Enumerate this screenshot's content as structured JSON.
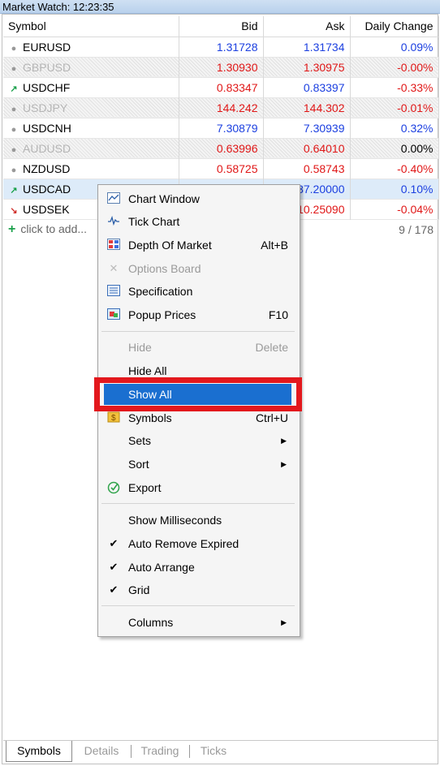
{
  "window": {
    "title": "Market Watch: 12:23:35"
  },
  "columns": {
    "symbol": "Symbol",
    "bid": "Bid",
    "ask": "Ask",
    "change": "Daily Change"
  },
  "rows": [
    {
      "symbol": "EURUSD",
      "bid": "1.31728",
      "ask": "1.31734",
      "change": "0.09%"
    },
    {
      "symbol": "GBPUSD",
      "bid": "1.30930",
      "ask": "1.30975",
      "change": "-0.00%"
    },
    {
      "symbol": "USDCHF",
      "bid": "0.83347",
      "ask": "0.83397",
      "change": "-0.33%"
    },
    {
      "symbol": "USDJPY",
      "bid": "144.242",
      "ask": "144.302",
      "change": "-0.01%"
    },
    {
      "symbol": "USDCNH",
      "bid": "7.30879",
      "ask": "7.30939",
      "change": "0.32%"
    },
    {
      "symbol": "AUDUSD",
      "bid": "0.63996",
      "ask": "0.64010",
      "change": "0.00%"
    },
    {
      "symbol": "NZDUSD",
      "bid": "0.58725",
      "ask": "0.58743",
      "change": "-0.40%"
    },
    {
      "symbol": "USDCAD",
      "bid": "",
      "ask": "37.20000",
      "change": "0.10%"
    },
    {
      "symbol": "USDSEK",
      "bid": "",
      "ask": "10.25090",
      "change": "-0.04%"
    }
  ],
  "add_row": {
    "label": "click to add...",
    "count": "9 / 178"
  },
  "context_menu": {
    "chart_window": "Chart Window",
    "tick_chart": "Tick Chart",
    "depth_of_market": "Depth Of Market",
    "depth_shortcut": "Alt+B",
    "options_board": "Options Board",
    "specification": "Specification",
    "popup_prices": "Popup Prices",
    "popup_shortcut": "F10",
    "hide": "Hide",
    "hide_shortcut": "Delete",
    "hide_all": "Hide All",
    "show_all": "Show All",
    "symbols": "Symbols",
    "symbols_shortcut": "Ctrl+U",
    "sets": "Sets",
    "sort": "Sort",
    "export": "Export",
    "show_milliseconds": "Show Milliseconds",
    "auto_remove_expired": "Auto Remove Expired",
    "auto_arrange": "Auto Arrange",
    "grid": "Grid",
    "columns": "Columns"
  },
  "tabs": [
    "Symbols",
    "Details",
    "Trading",
    "Ticks"
  ],
  "colors": {
    "highlight": "#1a6fd0",
    "annotation": "#e3181d",
    "up": "#1b3fe0",
    "down": "#e01717"
  }
}
